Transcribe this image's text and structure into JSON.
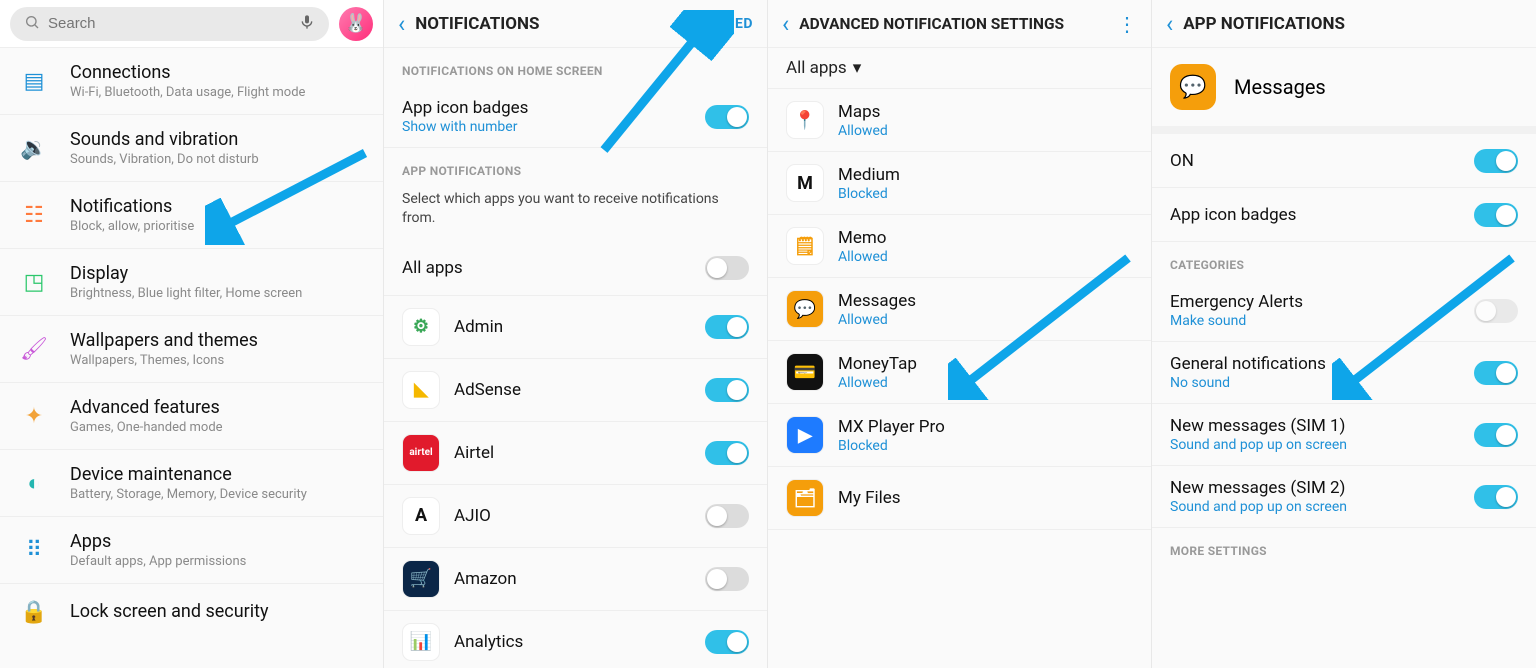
{
  "panel1": {
    "search_placeholder": "Search",
    "items": [
      {
        "title": "Connections",
        "sub": "Wi-Fi, Bluetooth, Data usage, Flight mode",
        "color": "#1e90d6",
        "glyph": "▤"
      },
      {
        "title": "Sounds and vibration",
        "sub": "Sounds, Vibration, Do not disturb",
        "color": "#1e90d6",
        "glyph": "🔉"
      },
      {
        "title": "Notifications",
        "sub": "Block, allow, prioritise",
        "color": "#ff7a3d",
        "glyph": "☷"
      },
      {
        "title": "Display",
        "sub": "Brightness, Blue light filter, Home screen",
        "color": "#2bc76b",
        "glyph": "◳"
      },
      {
        "title": "Wallpapers and themes",
        "sub": "Wallpapers, Themes, Icons",
        "color": "#c95bd9",
        "glyph": "🖌"
      },
      {
        "title": "Advanced features",
        "sub": "Games, One-handed mode",
        "color": "#f2a33a",
        "glyph": "✦"
      },
      {
        "title": "Device maintenance",
        "sub": "Battery, Storage, Memory, Device security",
        "color": "#23b6b0",
        "glyph": "◐"
      },
      {
        "title": "Apps",
        "sub": "Default apps, App permissions",
        "color": "#1e90d6",
        "glyph": "⠿"
      },
      {
        "title": "Lock screen and security",
        "sub": "",
        "color": "#1e90d6",
        "glyph": "🔒"
      }
    ]
  },
  "panel2": {
    "title": "NOTIFICATIONS",
    "action": "ADVANCED",
    "sec_home": "NOTIFICATIONS ON HOME SCREEN",
    "badges": {
      "title": "App icon badges",
      "sub": "Show with number",
      "on": true
    },
    "sec_apps": "APP NOTIFICATIONS",
    "desc": "Select which apps you want to receive notifications from.",
    "all_apps": "All apps",
    "apps": [
      {
        "name": "Admin",
        "on": true,
        "bg": "#fff",
        "fg": "#3aa757",
        "glyph": "⚙"
      },
      {
        "name": "AdSense",
        "on": true,
        "bg": "#fff",
        "fg": "#f5b800",
        "glyph": "◣"
      },
      {
        "name": "Airtel",
        "on": true,
        "bg": "#e11a2c",
        "fg": "#fff",
        "glyph": "airtel"
      },
      {
        "name": "AJIO",
        "on": false,
        "bg": "#fff",
        "fg": "#111",
        "glyph": "A"
      },
      {
        "name": "Amazon",
        "on": false,
        "bg": "#0b2647",
        "fg": "#fff",
        "glyph": "🛒"
      },
      {
        "name": "Analytics",
        "on": true,
        "bg": "#fff",
        "fg": "#f59e0b",
        "glyph": "📊"
      }
    ]
  },
  "panel3": {
    "title": "ADVANCED NOTIFICATION SETTINGS",
    "filter": "All apps",
    "apps": [
      {
        "name": "Maps",
        "status": "Allowed",
        "bg": "#fff",
        "fg": "#0f9d58",
        "glyph": "📍"
      },
      {
        "name": "Medium",
        "status": "Blocked",
        "bg": "#fff",
        "fg": "#111",
        "glyph": "M"
      },
      {
        "name": "Memo",
        "status": "Allowed",
        "bg": "#fff",
        "fg": "#f59e0b",
        "glyph": "🗒"
      },
      {
        "name": "Messages",
        "status": "Allowed",
        "bg": "#f59e0b",
        "fg": "#fff",
        "glyph": "💬"
      },
      {
        "name": "MoneyTap",
        "status": "Allowed",
        "bg": "#111",
        "fg": "#fff",
        "glyph": "💳"
      },
      {
        "name": "MX Player Pro",
        "status": "Blocked",
        "bg": "#1e7bff",
        "fg": "#fff",
        "glyph": "▶"
      },
      {
        "name": "My Files",
        "status": "",
        "bg": "#f59e0b",
        "fg": "#fff",
        "glyph": "🗂"
      }
    ]
  },
  "panel4": {
    "title": "APP NOTIFICATIONS",
    "app": "Messages",
    "on_label": "ON",
    "on": true,
    "badges": {
      "title": "App icon badges",
      "on": true
    },
    "cat_label": "CATEGORIES",
    "cats": [
      {
        "title": "Emergency Alerts",
        "sub": "Make sound",
        "on": false,
        "disabled": true
      },
      {
        "title": "General notifications",
        "sub": "No sound",
        "on": true
      },
      {
        "title": "New messages (SIM 1)",
        "sub": "Sound and pop up on screen",
        "on": true
      },
      {
        "title": "New messages (SIM 2)",
        "sub": "Sound and pop up on screen",
        "on": true
      }
    ],
    "more_label": "MORE SETTINGS"
  }
}
